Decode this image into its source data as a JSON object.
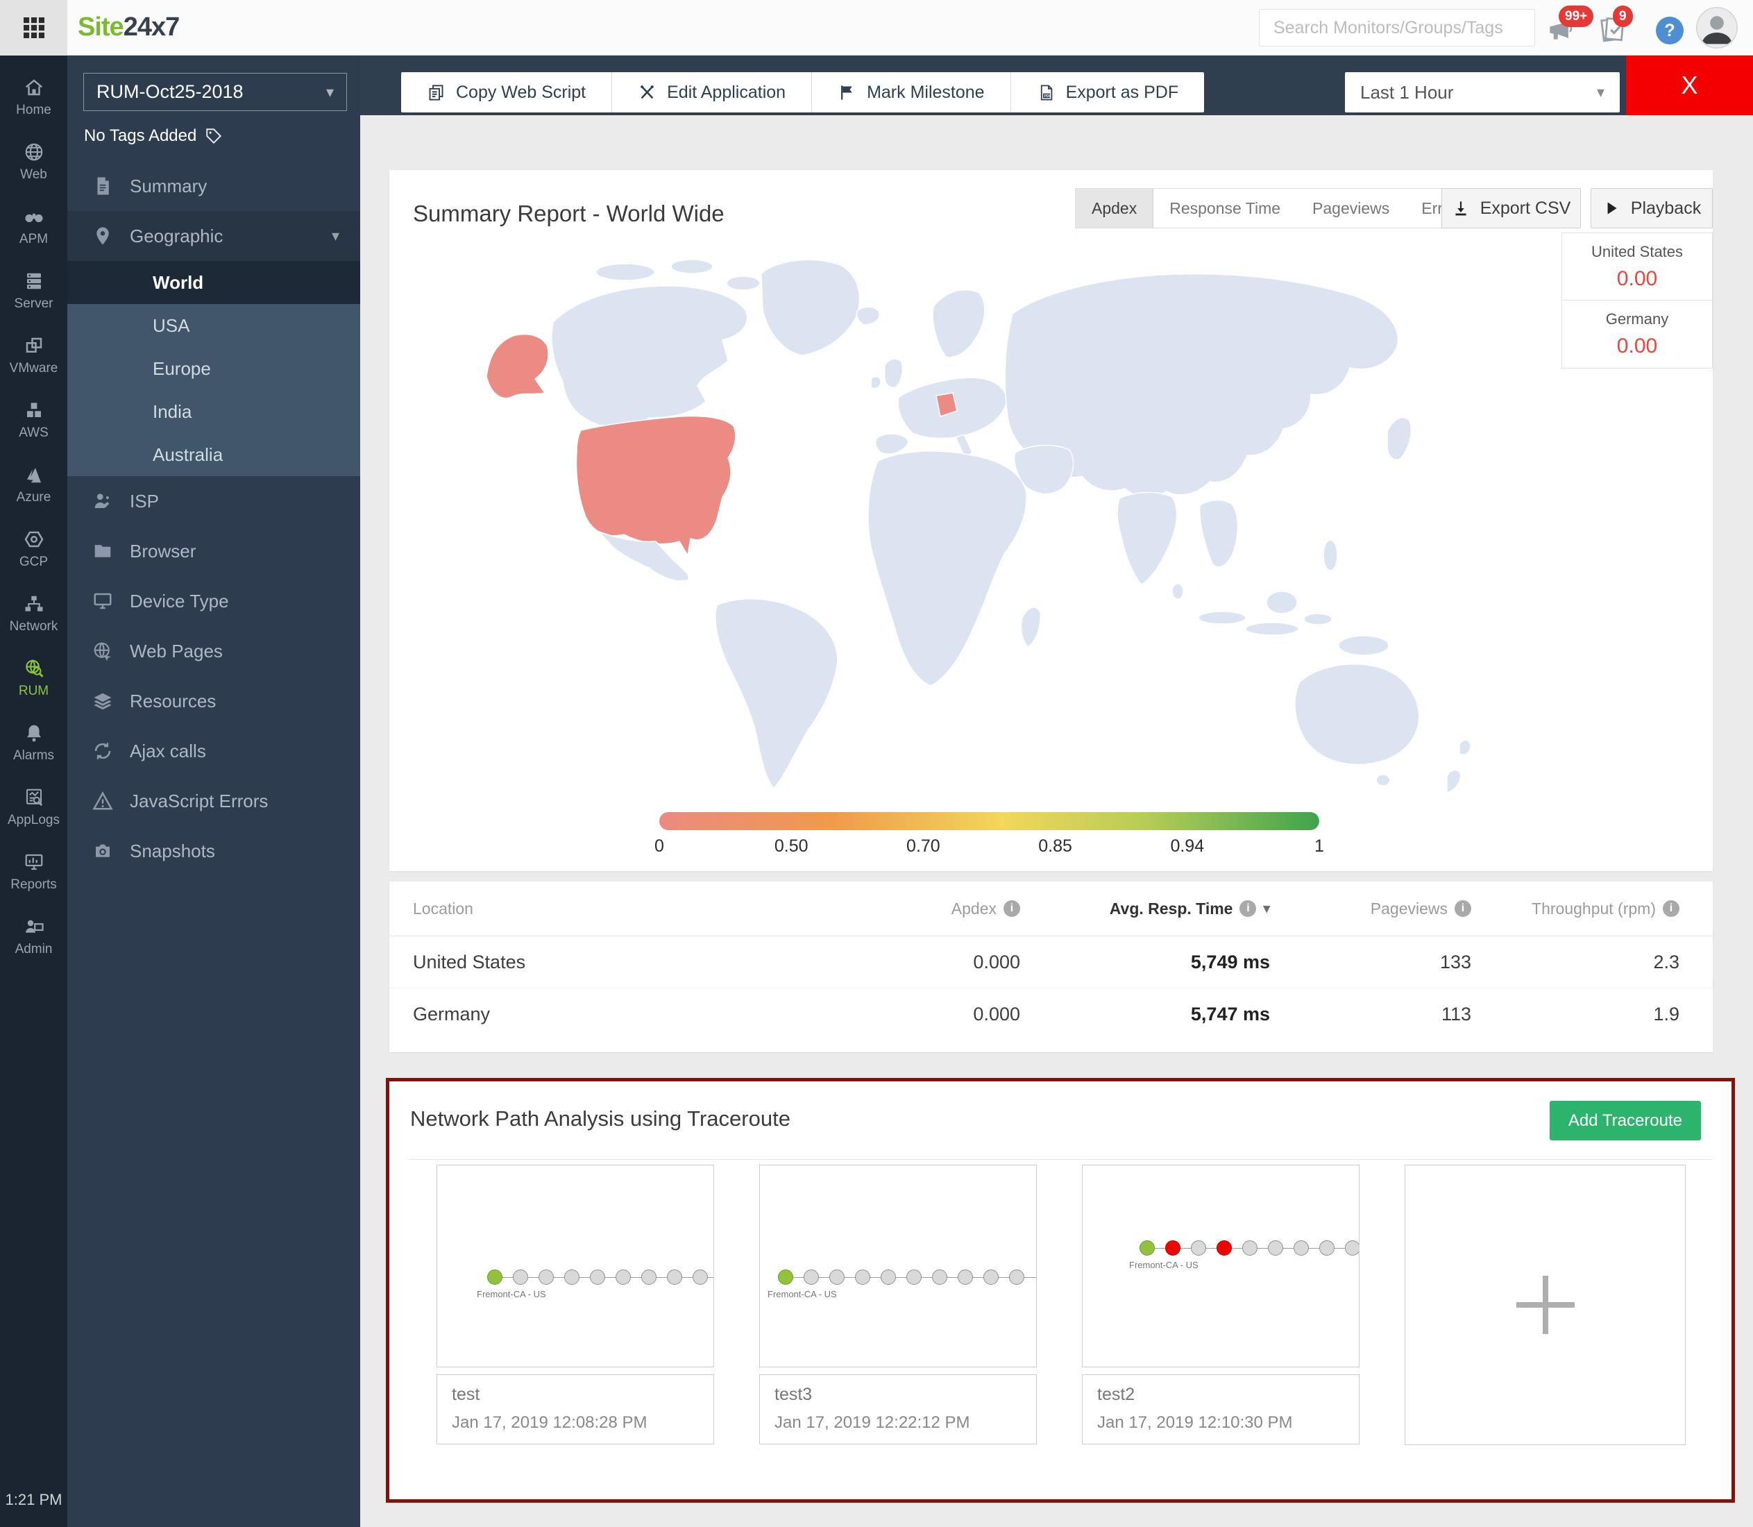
{
  "colors": {
    "brand-green": "#7db831",
    "rum-green": "#8ac43f",
    "add-green": "#2cb46c",
    "close-red": "#f40000",
    "value-red": "#e8473f",
    "map-land": "#dce4f2",
    "map-hot": "#eb8b84",
    "node-green": "#94c13d",
    "node-red": "#ee0400",
    "annotation-red": "#7d150d"
  },
  "header": {
    "logo_site": "Site",
    "logo_24x7": "24x7",
    "search_placeholder": "Search Monitors/Groups/Tags",
    "announce_badge": "99+",
    "tasks_badge": "9",
    "help_label": "?"
  },
  "rail": {
    "clock": "1:21 PM",
    "items": [
      {
        "id": "home",
        "label": "Home",
        "icon": "home-icon"
      },
      {
        "id": "web",
        "label": "Web",
        "icon": "web-icon"
      },
      {
        "id": "apm",
        "label": "APM",
        "icon": "apm-icon"
      },
      {
        "id": "server",
        "label": "Server",
        "icon": "server-icon"
      },
      {
        "id": "vmware",
        "label": "VMware",
        "icon": "vmware-icon"
      },
      {
        "id": "aws",
        "label": "AWS",
        "icon": "aws-icon"
      },
      {
        "id": "azure",
        "label": "Azure",
        "icon": "azure-icon"
      },
      {
        "id": "gcp",
        "label": "GCP",
        "icon": "gcp-icon"
      },
      {
        "id": "network",
        "label": "Network",
        "icon": "network-icon"
      },
      {
        "id": "rum",
        "label": "RUM",
        "icon": "rum-icon",
        "active": true
      },
      {
        "id": "alarms",
        "label": "Alarms",
        "icon": "alarms-icon"
      },
      {
        "id": "applogs",
        "label": "AppLogs",
        "icon": "applogs-icon"
      },
      {
        "id": "reports",
        "label": "Reports",
        "icon": "reports-icon"
      },
      {
        "id": "admin",
        "label": "Admin",
        "icon": "admin-icon"
      }
    ]
  },
  "sidebar": {
    "monitor_name": "RUM-Oct25-2018",
    "tags_label": "No Tags Added",
    "menu": [
      {
        "id": "summary",
        "label": "Summary",
        "icon": "summary-icon"
      },
      {
        "id": "geographic",
        "label": "Geographic",
        "icon": "geographic-icon",
        "expanded": true,
        "children": [
          {
            "id": "world",
            "label": "World",
            "active": true
          },
          {
            "id": "usa",
            "label": "USA"
          },
          {
            "id": "europe",
            "label": "Europe"
          },
          {
            "id": "india",
            "label": "India"
          },
          {
            "id": "australia",
            "label": "Australia"
          }
        ]
      },
      {
        "id": "isp",
        "label": "ISP",
        "icon": "isp-icon"
      },
      {
        "id": "browser",
        "label": "Browser",
        "icon": "browser-icon"
      },
      {
        "id": "device-type",
        "label": "Device Type",
        "icon": "device-icon"
      },
      {
        "id": "web-pages",
        "label": "Web Pages",
        "icon": "webpages-icon"
      },
      {
        "id": "resources",
        "label": "Resources",
        "icon": "resources-icon"
      },
      {
        "id": "ajax-calls",
        "label": "Ajax calls",
        "icon": "ajax-icon"
      },
      {
        "id": "javascript-errors",
        "label": "JavaScript Errors",
        "icon": "jserror-icon"
      },
      {
        "id": "snapshots",
        "label": "Snapshots",
        "icon": "snapshots-icon"
      }
    ]
  },
  "toolbar": {
    "buttons": [
      {
        "id": "copy-web-script",
        "label": "Copy Web Script",
        "icon": "copy-icon"
      },
      {
        "id": "edit-application",
        "label": "Edit Application",
        "icon": "tools-icon"
      },
      {
        "id": "mark-milestone",
        "label": "Mark Milestone",
        "icon": "flag-icon"
      },
      {
        "id": "export-as-pdf",
        "label": "Export as PDF",
        "icon": "pdf-icon"
      }
    ],
    "time_range": "Last 1 Hour",
    "close_label": "X"
  },
  "summary": {
    "title": "Summary Report - World Wide",
    "tabs": [
      "Apdex",
      "Response Time",
      "Pageviews",
      "Error"
    ],
    "active_tab": "Apdex",
    "export_csv_label": "Export CSV",
    "playback_label": "Playback",
    "highlighted_countries": [
      "United States",
      "Germany"
    ],
    "map_legend": [
      {
        "name": "United States",
        "value": "0.00"
      },
      {
        "name": "Germany",
        "value": "0.00"
      }
    ],
    "scale_ticks": [
      "0",
      "0.50",
      "0.70",
      "0.85",
      "0.94",
      "1"
    ]
  },
  "geo_table": {
    "columns": [
      {
        "label": "Location",
        "info": false,
        "numeric": false
      },
      {
        "label": "Apdex",
        "info": true,
        "numeric": true
      },
      {
        "label": "Avg. Resp. Time",
        "info": true,
        "numeric": true,
        "sorted": true
      },
      {
        "label": "Pageviews",
        "info": true,
        "numeric": true
      },
      {
        "label": "Throughput (rpm)",
        "info": true,
        "numeric": true
      }
    ],
    "rows": [
      {
        "location": "United States",
        "apdex": "0.000",
        "avg_resp_time": "5,749 ms",
        "pageviews": "133",
        "throughput": "2.3"
      },
      {
        "location": "Germany",
        "apdex": "0.000",
        "avg_resp_time": "5,747 ms",
        "pageviews": "113",
        "throughput": "1.9"
      }
    ]
  },
  "traceroute": {
    "title": "Network Path Analysis using Traceroute",
    "add_button_label": "Add Traceroute",
    "cards": [
      {
        "name": "test",
        "timestamp": "Jan 17, 2019 12:08:28 PM",
        "origin_label": "Fremont-CA - US",
        "hops": [
          "start",
          "ok",
          "ok",
          "ok",
          "ok",
          "ok",
          "ok",
          "ok",
          "ok"
        ]
      },
      {
        "name": "test3",
        "timestamp": "Jan 17, 2019 12:22:12 PM",
        "origin_label": "Fremont-CA - US",
        "hops": [
          "start",
          "ok",
          "ok",
          "ok",
          "ok",
          "ok",
          "ok",
          "ok",
          "ok",
          "ok"
        ]
      },
      {
        "name": "test2",
        "timestamp": "Jan 17, 2019 12:10:30 PM",
        "origin_label": "Fremont-CA - US",
        "hops": [
          "start",
          "error",
          "ok",
          "error",
          "ok",
          "ok",
          "ok",
          "ok",
          "ok"
        ]
      }
    ]
  },
  "chart_data": {
    "type": "table",
    "title": "Summary Report - World Wide (Apdex choropleth)",
    "columns": [
      "Location",
      "Apdex",
      "Avg. Resp. Time",
      "Pageviews",
      "Throughput (rpm)"
    ],
    "rows": [
      [
        "United States",
        "0.000",
        "5,749 ms",
        "133",
        "2.3"
      ],
      [
        "Germany",
        "0.000",
        "5,747 ms",
        "113",
        "1.9"
      ]
    ],
    "map_values": {
      "United States": 0.0,
      "Germany": 0.0
    },
    "apdex_scale_ticks": [
      0,
      0.5,
      0.7,
      0.85,
      0.94,
      1
    ]
  }
}
